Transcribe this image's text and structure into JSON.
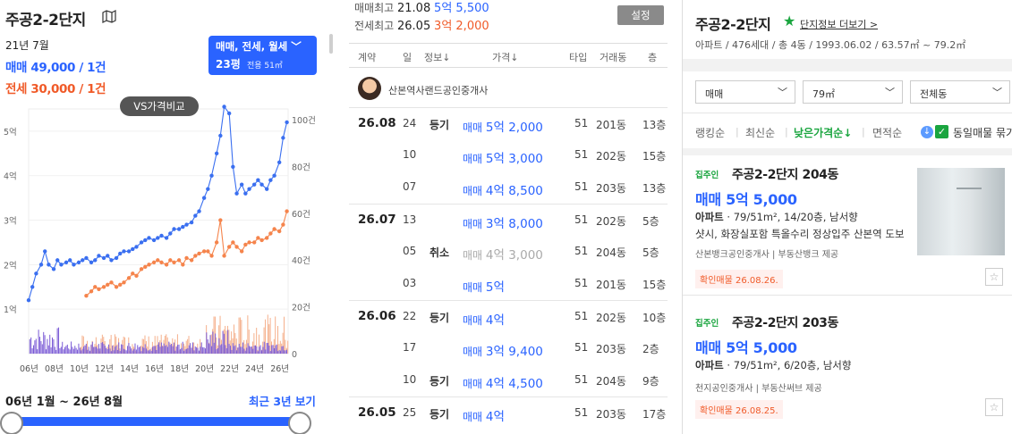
{
  "left": {
    "title": "주공2-2단지",
    "date": "21년 7월",
    "sale": "매매 49,000 / 1건",
    "lease": "전세 30,000 / 1건",
    "filter": {
      "types": "매매, 전세, 월세 ﹀",
      "size": "23평",
      "size_sub": "전용 51㎡"
    },
    "vs_button": "VS가격비교",
    "range_label": "06년 1월 ~ 26년 8월",
    "recent_button": "최근 3년 보기"
  },
  "middle": {
    "high_sale_label": "매매최고",
    "high_sale_date": "21.08",
    "high_sale_price": "5억 5,500",
    "high_lease_label": "전세최고",
    "high_lease_date": "26.05",
    "high_lease_price": "3억 2,000",
    "settings": "설정",
    "columns": [
      "계약",
      "일",
      "정보↓",
      "가격↓",
      "타입",
      "거래동",
      "층"
    ],
    "agent": "산본역사랜드공인중개사",
    "rows": [
      {
        "month": "26.08",
        "day": "24",
        "info": "등기",
        "kind": "매매",
        "price": "5억 2,000",
        "type": "51",
        "bldg": "201동",
        "floor": "13층",
        "cancel": false
      },
      {
        "month": "",
        "day": "10",
        "info": "",
        "kind": "매매",
        "price": "5억 3,000",
        "type": "51",
        "bldg": "202동",
        "floor": "15층",
        "cancel": false
      },
      {
        "month": "",
        "day": "07",
        "info": "",
        "kind": "매매",
        "price": "4억 8,500",
        "type": "51",
        "bldg": "203동",
        "floor": "13층",
        "cancel": false
      },
      {
        "month": "26.07",
        "day": "13",
        "info": "",
        "kind": "매매",
        "price": "3억 8,000",
        "type": "51",
        "bldg": "202동",
        "floor": "5층",
        "cancel": false
      },
      {
        "month": "",
        "day": "05",
        "info": "취소",
        "kind": "매매",
        "price": "4억 3,000",
        "type": "51",
        "bldg": "204동",
        "floor": "5층",
        "cancel": true
      },
      {
        "month": "",
        "day": "03",
        "info": "",
        "kind": "매매",
        "price": "5억",
        "type": "51",
        "bldg": "201동",
        "floor": "15층",
        "cancel": false
      },
      {
        "month": "26.06",
        "day": "22",
        "info": "등기",
        "kind": "매매",
        "price": "4억",
        "type": "51",
        "bldg": "202동",
        "floor": "10층",
        "cancel": false
      },
      {
        "month": "",
        "day": "17",
        "info": "",
        "kind": "매매",
        "price": "3억 9,400",
        "type": "51",
        "bldg": "203동",
        "floor": "2층",
        "cancel": false
      },
      {
        "month": "",
        "day": "10",
        "info": "등기",
        "kind": "매매",
        "price": "4억 4,500",
        "type": "51",
        "bldg": "204동",
        "floor": "9층",
        "cancel": false
      },
      {
        "month": "26.05",
        "day": "25",
        "info": "등기",
        "kind": "매매",
        "price": "4억",
        "type": "51",
        "bldg": "203동",
        "floor": "17층",
        "cancel": false
      }
    ]
  },
  "right": {
    "title": "주공2-2단지",
    "link": "단지정보 더보기 >",
    "info": "아파트 / 476세대 / 총 4동 / 1993.06.02 / 63.57㎡ ~ 79.2㎡",
    "selects": [
      "매매",
      "79㎡",
      "전체동"
    ],
    "sorts": [
      "랭킹순",
      "최신순",
      "낮은가격순↓",
      "면적순"
    ],
    "same_listing": "동일매물 묶기",
    "cards": [
      {
        "tag": "집주인",
        "name": "주공2-2단지 204동",
        "price": "매매 5억 5,000",
        "spec_b": "아파트",
        "spec": " · 79/51m², 14/20층, 남서향",
        "desc": "샷시, 화장실포함 특올수리 정상입주 산본역 도보",
        "agent": "산본뱅크공인중개사 | 부동산뱅크 제공",
        "badge": "확인매물 26.08.26."
      },
      {
        "tag": "집주인",
        "name": "주공2-2단지 203동",
        "price": "매매 5억 5,000",
        "spec_b": "아파트",
        "spec": " · 79/51m², 6/20층, 남서향",
        "desc": "",
        "agent": "천지공인중개사 | 부동산써브 제공",
        "badge": "확인매물 26.08.25."
      }
    ]
  },
  "chart_data": {
    "type": "line",
    "x_ticks": [
      "06년",
      "08년",
      "10년",
      "12년",
      "14년",
      "16년",
      "18년",
      "20년",
      "22년",
      "24년",
      "26년"
    ],
    "y_ticks_left": [
      "1억",
      "2억",
      "3억",
      "4억",
      "5억"
    ],
    "y_ticks_right": [
      "0",
      "20건",
      "40건",
      "60건",
      "80건",
      "100건"
    ],
    "ylim_price": [
      0,
      5.5
    ],
    "ylim_volume": [
      0,
      100
    ],
    "colors": {
      "sale": "#3a6ff0",
      "lease": "#f5844c",
      "sale_vol": "#7b5bd6",
      "lease_vol": "#f5b08c"
    },
    "series": [
      {
        "kind": "sale",
        "x": [
          2006.0,
          2006.3,
          2006.6,
          2007.0,
          2007.3,
          2007.6,
          2008.0,
          2008.3,
          2008.6,
          2009.0,
          2009.3,
          2009.6,
          2010.0,
          2010.3,
          2010.6,
          2011.0,
          2011.3,
          2011.6,
          2012.0,
          2012.3,
          2012.6,
          2013.0,
          2013.3,
          2013.6,
          2014.0,
          2014.3,
          2014.6,
          2015.0,
          2015.3,
          2015.6,
          2016.0,
          2016.3,
          2016.6,
          2017.0,
          2017.3,
          2017.6,
          2018.0,
          2018.3,
          2018.6,
          2019.0,
          2019.3,
          2019.6,
          2020.0,
          2020.3,
          2020.6,
          2021.0,
          2021.3,
          2021.6,
          2022.0,
          2022.3,
          2022.6,
          2023.0,
          2023.3,
          2023.6,
          2024.0,
          2024.3,
          2024.6,
          2025.0,
          2025.3,
          2025.6,
          2026.0,
          2026.3,
          2026.6
        ],
        "y": [
          1.2,
          1.5,
          1.8,
          2.0,
          2.3,
          2.0,
          1.9,
          2.1,
          2.0,
          2.05,
          2.1,
          2.0,
          2.05,
          2.1,
          2.15,
          2.05,
          2.1,
          2.2,
          2.15,
          2.2,
          2.1,
          2.15,
          2.25,
          2.3,
          2.3,
          2.35,
          2.4,
          2.5,
          2.55,
          2.6,
          2.55,
          2.6,
          2.65,
          2.6,
          2.7,
          2.8,
          2.8,
          2.85,
          2.9,
          2.95,
          3.1,
          3.2,
          3.5,
          3.7,
          4.0,
          4.5,
          4.9,
          5.55,
          5.4,
          4.2,
          3.6,
          3.8,
          3.6,
          3.7,
          3.8,
          3.9,
          3.8,
          3.7,
          3.9,
          4.0,
          4.3,
          4.85,
          5.2
        ]
      },
      {
        "kind": "lease",
        "x": [
          2010.6,
          2011.0,
          2011.3,
          2011.6,
          2012.0,
          2012.3,
          2012.6,
          2013.0,
          2013.3,
          2013.6,
          2014.0,
          2014.3,
          2014.6,
          2015.0,
          2015.3,
          2015.6,
          2016.0,
          2016.3,
          2016.6,
          2017.0,
          2017.3,
          2017.6,
          2018.0,
          2018.3,
          2018.6,
          2019.0,
          2019.3,
          2019.6,
          2020.0,
          2020.3,
          2020.6,
          2021.0,
          2021.3,
          2021.6,
          2022.0,
          2022.3,
          2022.6,
          2023.0,
          2023.3,
          2023.6,
          2024.0,
          2024.3,
          2024.6,
          2025.0,
          2025.3,
          2025.6,
          2026.0,
          2026.3,
          2026.6
        ],
        "y": [
          1.3,
          1.4,
          1.5,
          1.45,
          1.5,
          1.55,
          1.6,
          1.5,
          1.55,
          1.6,
          1.7,
          1.8,
          1.75,
          1.9,
          1.95,
          2.0,
          2.05,
          2.1,
          2.05,
          2.0,
          2.1,
          2.05,
          2.1,
          2.0,
          2.15,
          2.1,
          2.2,
          2.25,
          2.3,
          2.3,
          2.2,
          2.5,
          3.0,
          2.2,
          2.4,
          2.5,
          2.4,
          2.3,
          2.45,
          2.5,
          2.5,
          2.6,
          2.55,
          2.6,
          2.7,
          2.8,
          2.75,
          2.9,
          3.2
        ]
      }
    ]
  }
}
